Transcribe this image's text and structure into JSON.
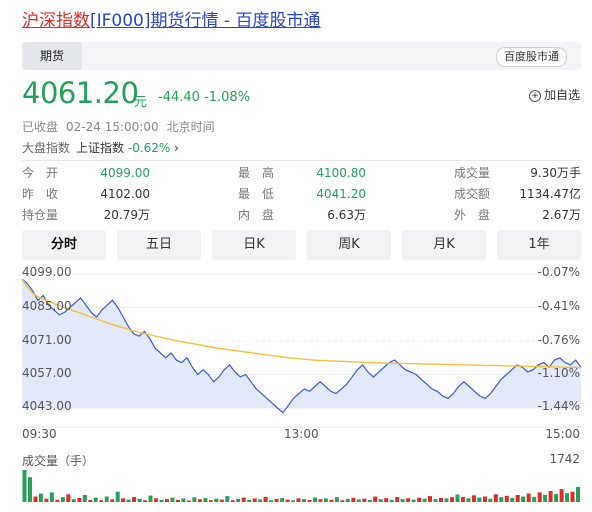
{
  "header": {
    "name": "沪深指数",
    "code": "[IF000]",
    "suffix": "期货行情 - 百度股市通"
  },
  "tabbar": {
    "tab": "期货",
    "brand": "百度股市通"
  },
  "quote": {
    "price": "4061.20",
    "unit": "元",
    "change": "-44.40",
    "change_pct": "-1.08%",
    "fav_label": "加自选",
    "status": "已收盘",
    "datetime": "02-24 15:00:00",
    "tz": "北京时间"
  },
  "market": {
    "label": "大盘指数",
    "name": "上证指数",
    "value": "-0.62%"
  },
  "stats": [
    {
      "k": "今　开",
      "v": "4099.00",
      "color": "#25a05a"
    },
    {
      "k": "最　高",
      "v": "4100.80",
      "color": "#25a05a"
    },
    {
      "k": "成交量",
      "v": "9.30万手",
      "color": "#333333"
    },
    {
      "k": "昨　收",
      "v": "4102.00",
      "color": "#333333"
    },
    {
      "k": "最　低",
      "v": "4041.20",
      "color": "#25a05a"
    },
    {
      "k": "成交额",
      "v": "1134.47亿",
      "color": "#333333"
    },
    {
      "k": "持仓量",
      "v": "20.79万",
      "color": "#333333"
    },
    {
      "k": "内　盘",
      "v": "6.63万",
      "color": "#333333"
    },
    {
      "k": "外　盘",
      "v": "2.67万",
      "color": "#333333"
    }
  ],
  "periods": [
    "分时",
    "五日",
    "日K",
    "周K",
    "月K",
    "1年"
  ],
  "active_period": "分时",
  "colors": {
    "up": "#e02b2b",
    "down": "#25a05a",
    "line": "#3a5ad8",
    "avg": "#f0c23c",
    "fill": "#dfe5f9"
  },
  "chart_data": {
    "type": "line",
    "y_left_ticks": [
      "4099.00",
      "4085.00",
      "4071.00",
      "4057.00",
      "4043.00"
    ],
    "y_right_ticks": [
      "-0.07%",
      "-0.41%",
      "-0.76%",
      "-1.10%",
      "-1.44%"
    ],
    "ylim": [
      4043.0,
      4099.0
    ],
    "x_ticks": [
      "09:30",
      "13:00",
      "15:00"
    ],
    "series": [
      {
        "values": [
          4097,
          4095,
          4092,
          4088,
          4090,
          4086,
          4084,
          4082,
          4083,
          4085,
          4087,
          4089,
          4086,
          4083,
          4081,
          4084,
          4086,
          4088,
          4085,
          4081,
          4077,
          4074,
          4073,
          4075,
          4072,
          4068,
          4066,
          4064,
          4066,
          4063,
          4062,
          4064,
          4060,
          4057,
          4059,
          4057,
          4054,
          4056,
          4059,
          4061,
          4058,
          4056,
          4057,
          4054,
          4051,
          4049,
          4047,
          4045,
          4043,
          4041,
          4044,
          4047,
          4049,
          4051,
          4050,
          4052,
          4054,
          4052,
          4050,
          4049,
          4051,
          4053,
          4056,
          4059,
          4061,
          4058,
          4056,
          4058,
          4060,
          4062,
          4063,
          4061,
          4059,
          4058,
          4057,
          4055,
          4053,
          4051,
          4050,
          4048,
          4047,
          4049,
          4052,
          4054,
          4052,
          4050,
          4048,
          4047,
          4049,
          4052,
          4055,
          4057,
          4059,
          4061,
          4060,
          4058,
          4059,
          4061,
          4062,
          4060,
          4063,
          4064,
          4062,
          4061,
          4063,
          4060
        ]
      },
      {
        "values": [
          4097,
          4093.5,
          4091,
          4089.5,
          4088.5,
          4087.5,
          4086.7,
          4085.8,
          4085,
          4084.2,
          4083.4,
          4082.6,
          4081.8,
          4081,
          4080.2,
          4079.4,
          4078.6,
          4077.9,
          4077.2,
          4076.5,
          4075.8,
          4075.2,
          4074.6,
          4074.1,
          4073.6,
          4073.1,
          4072.6,
          4072.1,
          4071.6,
          4071.1,
          4070.7,
          4070.3,
          4069.9,
          4069.5,
          4069.1,
          4068.7,
          4068.3,
          4067.9,
          4067.6,
          4067.3,
          4067.0,
          4066.7,
          4066.4,
          4066.1,
          4065.8,
          4065.5,
          4065.2,
          4064.9,
          4064.6,
          4064.3,
          4064.0,
          4063.8,
          4063.6,
          4063.4,
          4063.2,
          4063.0,
          4062.9,
          4062.8,
          4062.7,
          4062.6,
          4062.5,
          4062.4,
          4062.3,
          4062.2,
          4062.1,
          4062.0,
          4061.9,
          4061.8,
          4061.8,
          4061.7,
          4061.7,
          4061.6,
          4061.6,
          4061.5,
          4061.5,
          4061.4,
          4061.4,
          4061.3,
          4061.3,
          4061.2,
          4061.2,
          4061.1,
          4061.1,
          4061.0,
          4061.0,
          4060.9,
          4060.9,
          4060.8,
          4060.8,
          4060.7,
          4060.7,
          4060.6,
          4060.6,
          4060.5,
          4060.5,
          4060.4,
          4060.4,
          4060.3,
          4060.3,
          4060.2,
          4060.2,
          4060.1,
          4060.1,
          4060.0,
          4060.0,
          4059.9
        ]
      }
    ]
  },
  "volume": {
    "label": "成交量（手）",
    "max": "1742",
    "bars": [
      {
        "v": 1742,
        "c": "down"
      },
      {
        "v": 1350,
        "c": "down"
      },
      {
        "v": 300,
        "c": "up"
      },
      {
        "v": 450,
        "c": "down"
      },
      {
        "v": 180,
        "c": "up"
      },
      {
        "v": 520,
        "c": "down"
      },
      {
        "v": 120,
        "c": "up"
      },
      {
        "v": 260,
        "c": "down"
      },
      {
        "v": 420,
        "c": "up"
      },
      {
        "v": 150,
        "c": "down"
      },
      {
        "v": 220,
        "c": "up"
      },
      {
        "v": 380,
        "c": "down"
      },
      {
        "v": 110,
        "c": "up"
      },
      {
        "v": 240,
        "c": "down"
      },
      {
        "v": 90,
        "c": "up"
      },
      {
        "v": 300,
        "c": "down"
      },
      {
        "v": 140,
        "c": "up"
      },
      {
        "v": 560,
        "c": "down"
      },
      {
        "v": 200,
        "c": "up"
      },
      {
        "v": 130,
        "c": "down"
      },
      {
        "v": 280,
        "c": "up"
      },
      {
        "v": 170,
        "c": "down"
      },
      {
        "v": 90,
        "c": "up"
      },
      {
        "v": 350,
        "c": "down"
      },
      {
        "v": 200,
        "c": "up"
      },
      {
        "v": 110,
        "c": "down"
      },
      {
        "v": 160,
        "c": "up"
      },
      {
        "v": 240,
        "c": "down"
      },
      {
        "v": 120,
        "c": "up"
      },
      {
        "v": 190,
        "c": "down"
      },
      {
        "v": 80,
        "c": "up"
      },
      {
        "v": 260,
        "c": "down"
      },
      {
        "v": 150,
        "c": "up"
      },
      {
        "v": 210,
        "c": "down"
      },
      {
        "v": 100,
        "c": "up"
      },
      {
        "v": 180,
        "c": "down"
      },
      {
        "v": 130,
        "c": "up"
      },
      {
        "v": 320,
        "c": "down"
      },
      {
        "v": 90,
        "c": "up"
      },
      {
        "v": 170,
        "c": "down"
      },
      {
        "v": 240,
        "c": "up"
      },
      {
        "v": 110,
        "c": "down"
      },
      {
        "v": 190,
        "c": "up"
      },
      {
        "v": 140,
        "c": "down"
      },
      {
        "v": 280,
        "c": "up"
      },
      {
        "v": 100,
        "c": "down"
      },
      {
        "v": 170,
        "c": "up"
      },
      {
        "v": 220,
        "c": "down"
      },
      {
        "v": 130,
        "c": "up"
      },
      {
        "v": 90,
        "c": "down"
      },
      {
        "v": 200,
        "c": "up"
      },
      {
        "v": 160,
        "c": "down"
      },
      {
        "v": 110,
        "c": "up"
      },
      {
        "v": 240,
        "c": "down"
      },
      {
        "v": 150,
        "c": "up"
      },
      {
        "v": 190,
        "c": "down"
      },
      {
        "v": 120,
        "c": "up"
      },
      {
        "v": 260,
        "c": "down"
      },
      {
        "v": 100,
        "c": "up"
      },
      {
        "v": 170,
        "c": "down"
      },
      {
        "v": 230,
        "c": "up"
      },
      {
        "v": 140,
        "c": "down"
      },
      {
        "v": 180,
        "c": "up"
      },
      {
        "v": 110,
        "c": "down"
      },
      {
        "v": 300,
        "c": "up"
      },
      {
        "v": 150,
        "c": "down"
      },
      {
        "v": 210,
        "c": "up"
      },
      {
        "v": 120,
        "c": "down"
      },
      {
        "v": 270,
        "c": "up"
      },
      {
        "v": 160,
        "c": "down"
      },
      {
        "v": 200,
        "c": "up"
      },
      {
        "v": 130,
        "c": "down"
      },
      {
        "v": 240,
        "c": "up"
      },
      {
        "v": 180,
        "c": "down"
      },
      {
        "v": 320,
        "c": "up"
      },
      {
        "v": 150,
        "c": "down"
      },
      {
        "v": 220,
        "c": "up"
      },
      {
        "v": 190,
        "c": "down"
      },
      {
        "v": 260,
        "c": "up"
      },
      {
        "v": 410,
        "c": "down"
      },
      {
        "v": 280,
        "c": "up"
      },
      {
        "v": 200,
        "c": "down"
      },
      {
        "v": 360,
        "c": "up"
      },
      {
        "v": 240,
        "c": "down"
      },
      {
        "v": 300,
        "c": "up"
      },
      {
        "v": 180,
        "c": "down"
      },
      {
        "v": 420,
        "c": "up"
      },
      {
        "v": 260,
        "c": "down"
      },
      {
        "v": 340,
        "c": "up"
      },
      {
        "v": 220,
        "c": "down"
      },
      {
        "v": 380,
        "c": "up"
      },
      {
        "v": 300,
        "c": "down"
      },
      {
        "v": 460,
        "c": "up"
      },
      {
        "v": 280,
        "c": "down"
      },
      {
        "v": 520,
        "c": "up"
      },
      {
        "v": 390,
        "c": "down"
      },
      {
        "v": 600,
        "c": "up"
      },
      {
        "v": 430,
        "c": "down"
      },
      {
        "v": 700,
        "c": "up"
      },
      {
        "v": 480,
        "c": "down"
      },
      {
        "v": 560,
        "c": "up"
      },
      {
        "v": 820,
        "c": "down"
      }
    ]
  }
}
